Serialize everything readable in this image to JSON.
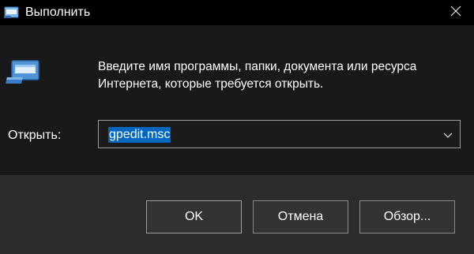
{
  "window": {
    "title": "Выполнить",
    "app_icon": "run-icon",
    "close_icon": "close-icon"
  },
  "content": {
    "description": "Введите имя программы, папки, документа или ресурса Интернета, которые требуется открыть.",
    "open_label": "Открыть:",
    "input": {
      "value": "gpedit.msc",
      "dropdown_icon": "chevron-down-icon"
    }
  },
  "buttons": {
    "ok": "OK",
    "cancel": "Отмена",
    "browse": "Обзор..."
  },
  "colors": {
    "selection": "#0067c0",
    "titlebar": "#000000",
    "content_bg": "#191919",
    "footer_bg": "#2c2c2c"
  }
}
